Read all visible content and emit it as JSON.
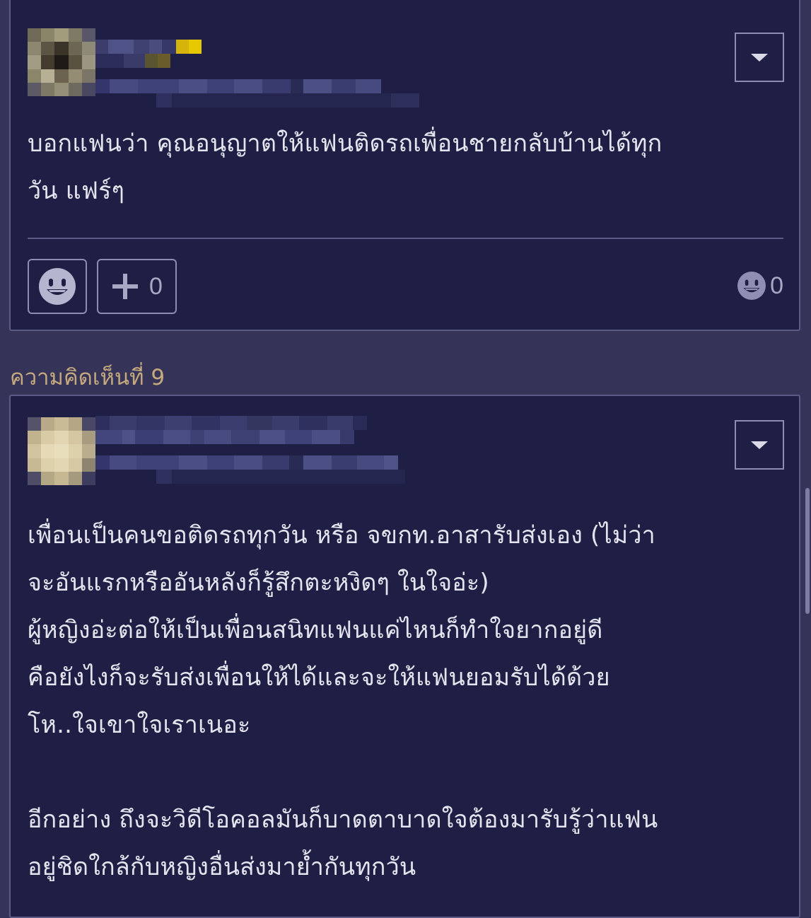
{
  "comments": [
    {
      "text": "บอกแฟนว่า คุณอนุญาตให้แฟนติดรถเพื่อนชายกลับบ้านได้ทุก\nวัน แฟร์ๆ",
      "plus_count": "0",
      "reaction_count": "0",
      "avatar_icon": "pixelated-avatar-icon",
      "emoji_icon": "grinning-face-icon"
    },
    {
      "number_label": "ความคิดเห็นที่ 9",
      "text": "เพื่อนเป็นคนขอติดรถทุกวัน หรือ จขกท.อาสารับส่งเอง (ไม่ว่า\nจะอันแรกหรืออันหลังก็รู้สึกตะหงิดๆ ในใจอ่ะ)\nผู้หญิงอ่ะต่อให้เป็นเพื่อนสนิทแฟนแค่ไหนก็ทำใจยากอยู่ดี\nคือยังไงก็จะรับส่งเพื่อนให้ได้และจะให้แฟนยอมรับได้ด้วย\nโห..ใจเขาใจเราเนอะ\n\nอีกอย่าง ถึงจะวิดีโอคอลมันก็บาดตาบาดใจต้องมารับรู้ว่าแฟน\nอยู่ชิดใกล้กับหญิงอื่นส่งมาย้ำกันทุกวัน",
      "avatar_icon": "pixelated-avatar-icon"
    }
  ],
  "colors": {
    "page_background": "#353458",
    "card_background": "#1f1f45",
    "card_border": "#5c5b86",
    "comment_number": "#c5a97e",
    "text": "#e4e4ee",
    "muted": "#a9a8c4"
  }
}
